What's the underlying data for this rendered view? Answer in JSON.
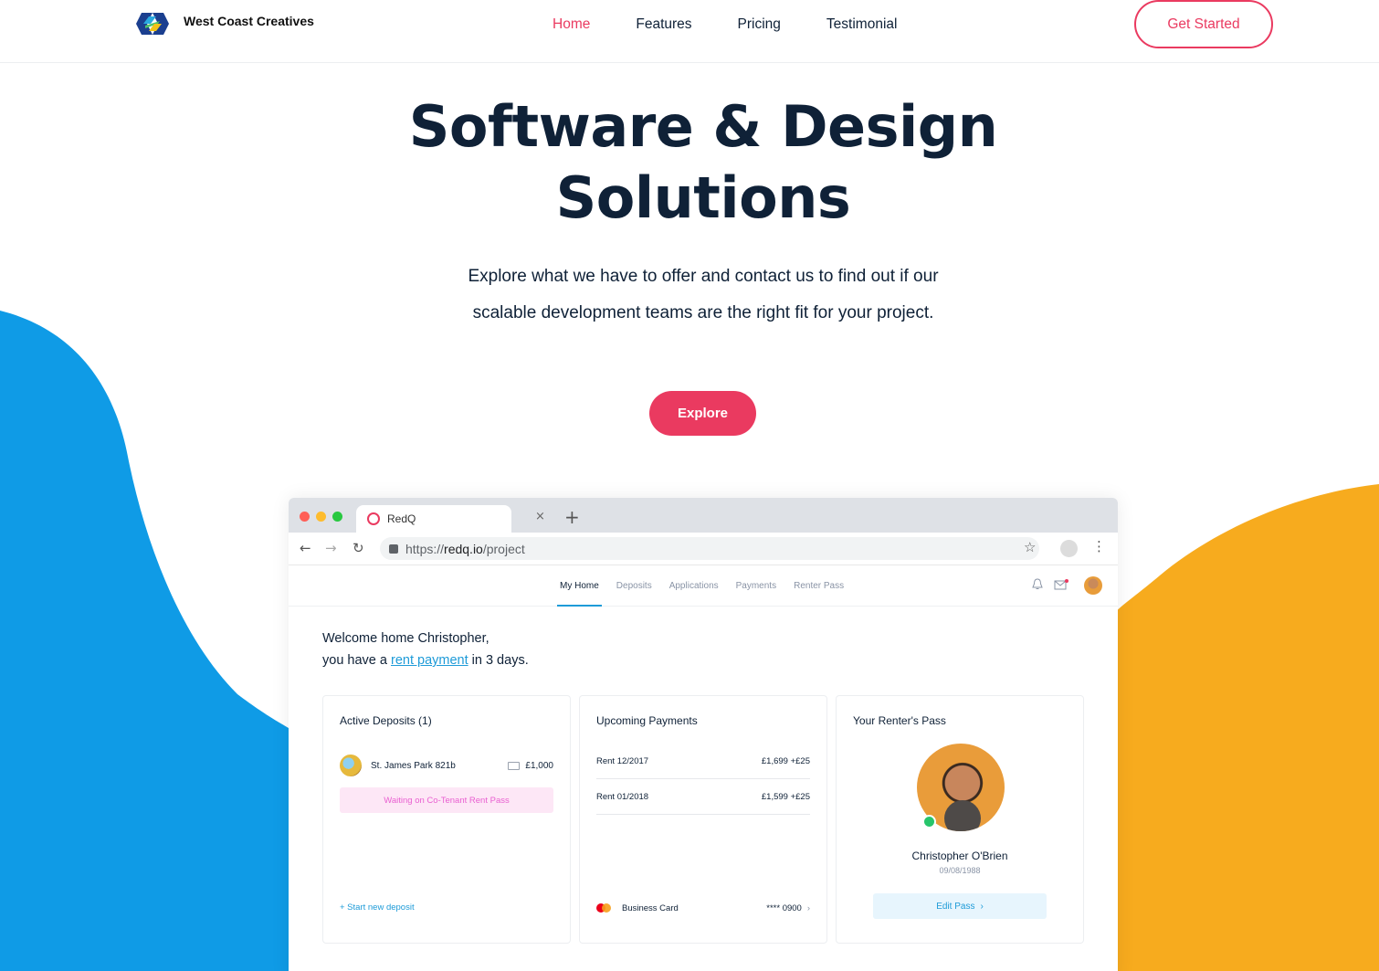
{
  "brand": {
    "name": "West Coast Creatives",
    "accent": "#ea3a60",
    "blue": "#0f9be6",
    "orange": "#f7ab1e"
  },
  "nav": {
    "items": [
      "Home",
      "Features",
      "Pricing",
      "Testimonial"
    ],
    "active": "Home",
    "cta": "Get Started"
  },
  "hero": {
    "title_line1": "Software & Design",
    "title_line2": "Solutions",
    "description": "Explore what we have to offer and contact us to find out if our scalable development teams are the right fit for your project.",
    "button": "Explore"
  },
  "browser": {
    "tab_title": "RedQ",
    "tab_close": "×",
    "new_tab": "+",
    "url_prefix": "https://",
    "url_host": "redq.io",
    "url_path": "/project"
  },
  "app": {
    "tabs": [
      "My Home",
      "Deposits",
      "Applications",
      "Payments",
      "Renter Pass"
    ],
    "active_tab": "My Home",
    "welcome_line1": "Welcome home Christopher,",
    "welcome_pre": "you have a ",
    "welcome_link": "rent payment",
    "welcome_post": " in 3 days.",
    "deposits": {
      "title": "Active Deposits (1)",
      "property": "St. James Park 821b",
      "amount": "£1,000",
      "status": "Waiting on Co-Tenant Rent Pass",
      "link": "+ Start new deposit"
    },
    "payments": {
      "title": "Upcoming Payments",
      "rows": [
        {
          "label": "Rent 12/2017",
          "amount": "£1,699  +£25"
        },
        {
          "label": "Rent 01/2018",
          "amount": "£1,599  +£25"
        }
      ],
      "card_label": "Business Card",
      "card_number": "**** 0900"
    },
    "pass": {
      "title": "Your Renter's Pass",
      "name": "Christopher O'Brien",
      "dob": "09/08/1988",
      "button": "Edit Pass"
    }
  }
}
